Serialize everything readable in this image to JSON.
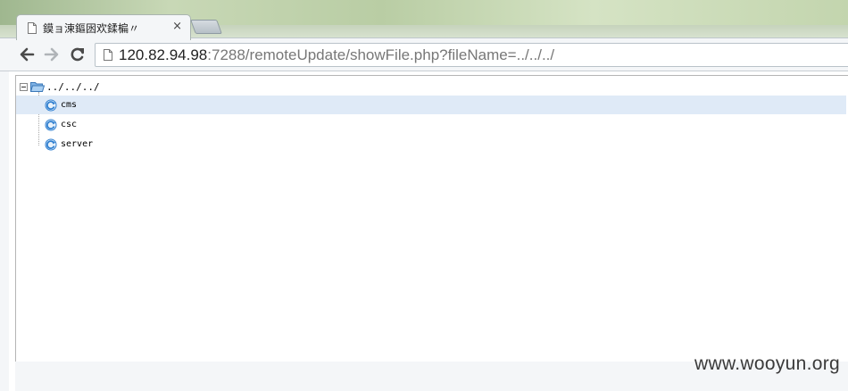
{
  "tab": {
    "title": "鏌ョ湅鏂囦欢鍒楄〃",
    "close": "×"
  },
  "address_bar": {
    "url_host": "120.82.94.98",
    "url_rest": ":7288/remoteUpdate/showFile.php?fileName=../../../"
  },
  "tree": {
    "root_label": "../../../",
    "items": [
      {
        "label": "cms",
        "selected": true
      },
      {
        "label": "csc",
        "selected": false
      },
      {
        "label": "server",
        "selected": false
      }
    ]
  },
  "watermark": "www.wooyun.org",
  "icons": {
    "back": "back-arrow-icon",
    "forward": "forward-arrow-icon",
    "reload": "reload-icon",
    "page": "page-icon",
    "folder": "folder-open-icon",
    "node": "refresh-node-icon"
  },
  "colors": {
    "selected_row": "#dfeaf7",
    "folder": "#4a8fd6",
    "node_icon": "#2f7fd0"
  }
}
